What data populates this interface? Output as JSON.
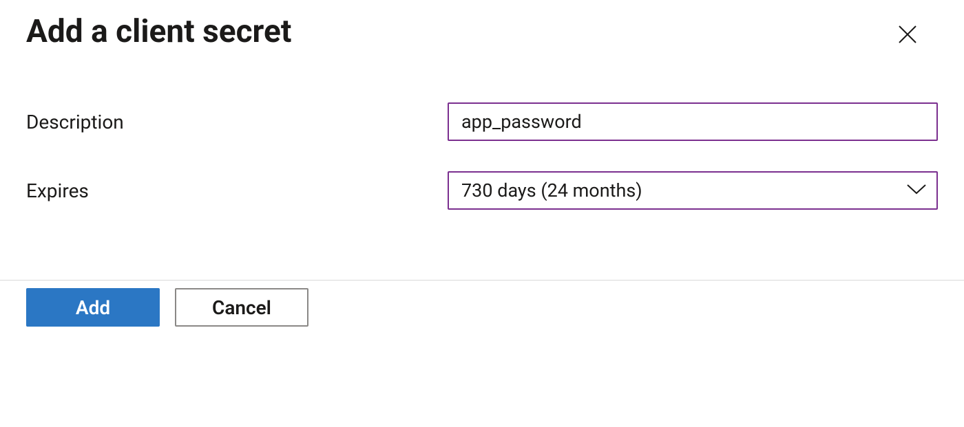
{
  "header": {
    "title": "Add a client secret"
  },
  "form": {
    "description": {
      "label": "Description",
      "value": "app_password"
    },
    "expires": {
      "label": "Expires",
      "selected": "730 days (24 months)"
    }
  },
  "footer": {
    "add_label": "Add",
    "cancel_label": "Cancel"
  },
  "colors": {
    "accent_border": "#7b2f8f",
    "primary_button": "#2b77c4"
  }
}
